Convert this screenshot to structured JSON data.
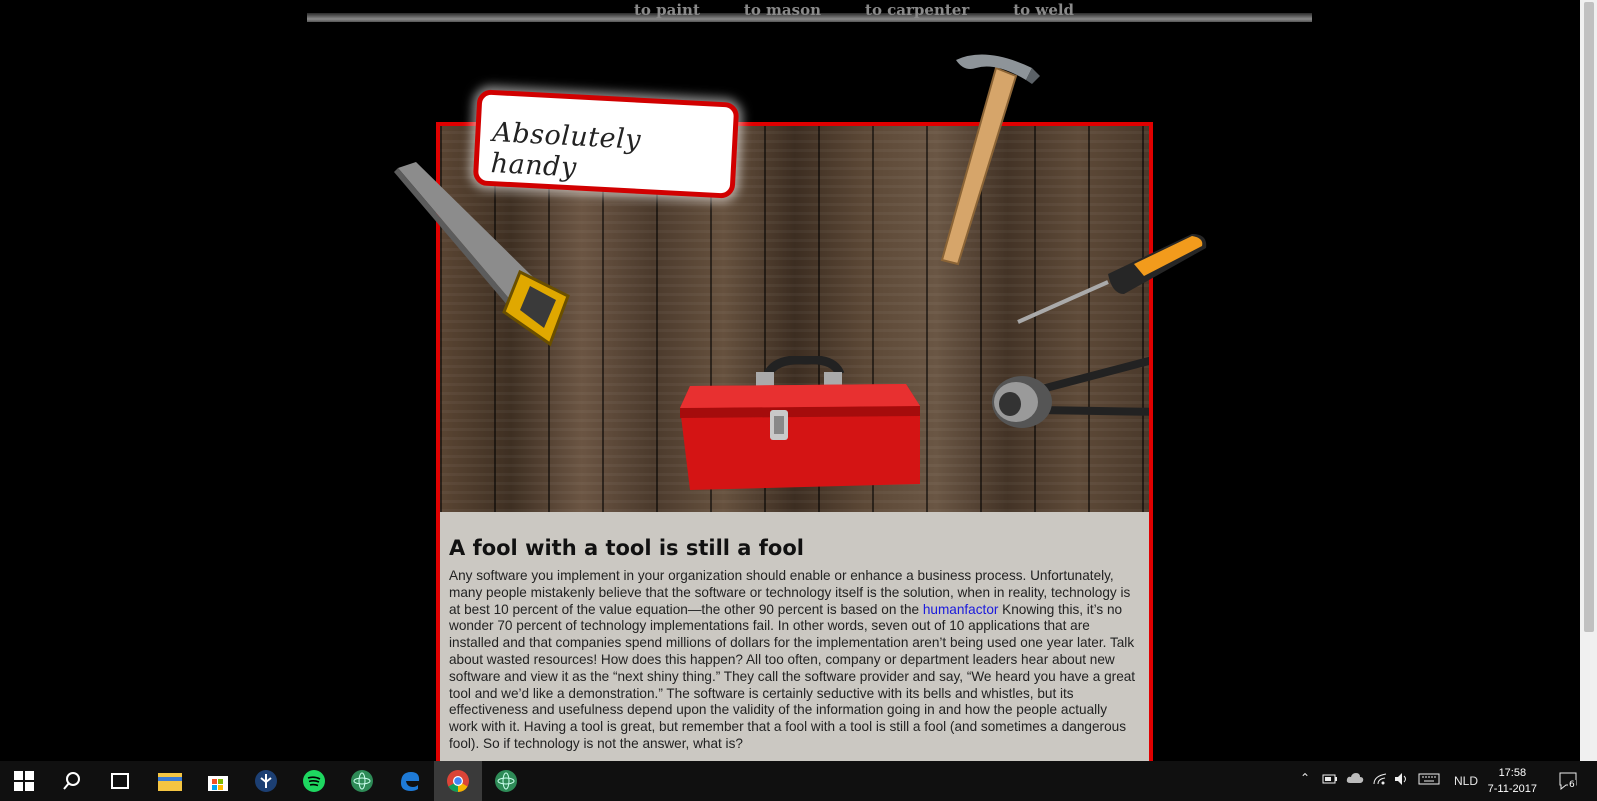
{
  "nav": {
    "items": [
      "to paint",
      "to mason",
      "to carpenter",
      "to weld"
    ]
  },
  "sign": {
    "text": "Absolutely handy"
  },
  "article": {
    "title": "A fool with a tool is still a fool",
    "p1": "Any software you implement in your organization should enable or enhance a business process. Unfortunately, many people mistakenly believe that the software or technology itself is the solution, when in reality, technology is at best 10 percent of the value equation—the other 90 percent is based on the ",
    "link": "humanfactor",
    "p2": " Knowing this, it’s no wonder 70 percent of technology implementations fail. In other words, seven out of 10 applications that are installed and that companies spend millions of dollars for the implementation aren’t being used one year later. Talk about wasted resources! How does this happen? All too often, company or department leaders hear about new software and view it as the “next shiny thing.” They call the software provider and say, “We heard you have a great tool and we’d like a demonstration.” The software is certainly seductive with its bells and whistles, but its effectiveness and usefulness depend upon the validity of the information going in and how the people actually work with it. Having a tool is great, but remember that a fool with a tool is still a fool (and sometimes a dangerous fool). So if technology is not the answer, what is?"
  },
  "taskbar": {
    "icons": [
      "windows-start-icon",
      "search-icon",
      "task-view-icon",
      "file-explorer-icon",
      "store-icon",
      "app-icon",
      "spotify-icon",
      "atom-icon",
      "edge-icon",
      "chrome-icon",
      "atom-icon-2"
    ],
    "language": "NLD",
    "time": "17:58",
    "date": "7-11-2017",
    "notifications": "6"
  }
}
